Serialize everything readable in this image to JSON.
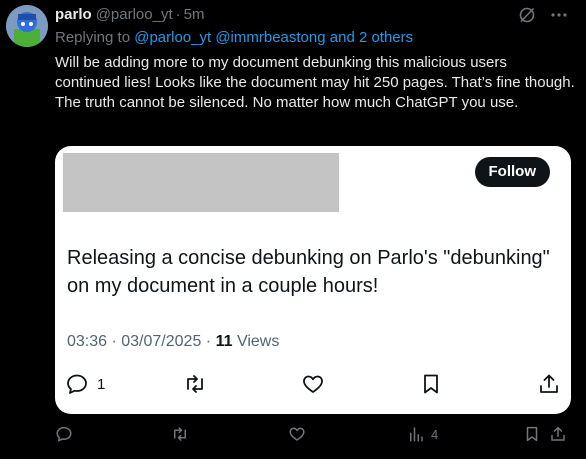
{
  "post": {
    "author_name": "parlo",
    "author_handle": "@parloo_yt",
    "separator": "·",
    "time": "5m",
    "replying_prefix": "Replying to",
    "replying_to": "@parloo_yt @immrbeastong and 2 others",
    "text": "Will be adding more to my document debunking this malicious users continued lies! Looks like the document may hit 250 pages. That’s fine though. The truth cannot be silenced. No matter how much ChatGPT you use."
  },
  "quoted": {
    "follow_label": "Follow",
    "text": "Releasing a concise debunking on Parlo's \"debunking\" on my document in a couple hours!",
    "time": "03:36 · 03/07/2025 ·",
    "views_count": "11",
    "views_label": "Views",
    "reply_count": "1"
  },
  "actions": {
    "views_count": "4"
  },
  "colors": {
    "link": "#1d9bf0",
    "muted": "#71767b",
    "card_bg": "#ffffff",
    "redaction": "#c4c4c4"
  },
  "icons": [
    "grok-icon",
    "more-icon",
    "reply-icon",
    "retweet-icon",
    "like-icon",
    "bookmark-icon",
    "share-icon",
    "views-icon"
  ]
}
